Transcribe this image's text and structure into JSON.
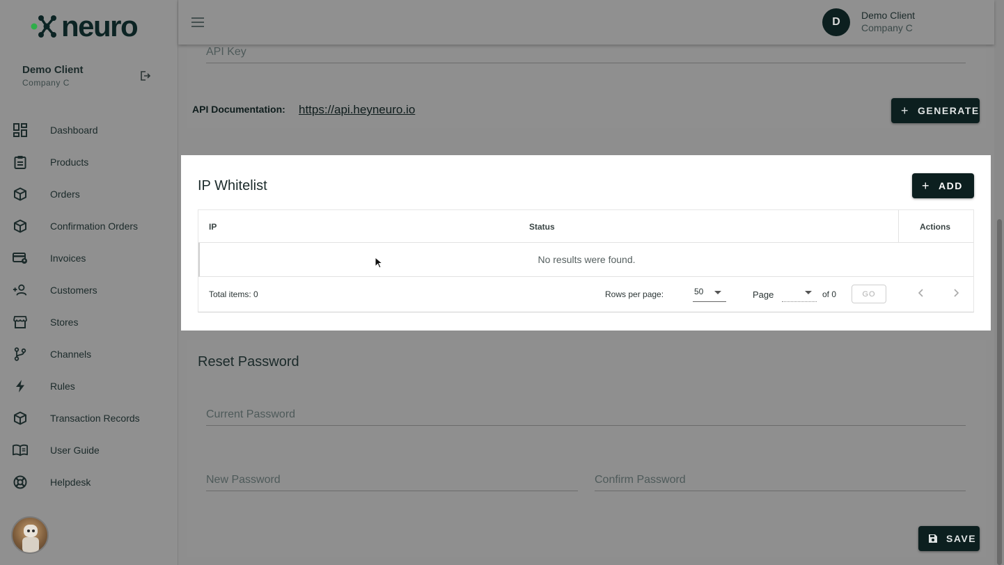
{
  "brand": {
    "name": "neuro"
  },
  "sidebar": {
    "user": {
      "name": "Demo Client",
      "company": "Company C"
    },
    "items": [
      {
        "label": "Dashboard",
        "icon": "dashboard-icon"
      },
      {
        "label": "Products",
        "icon": "clipboard-icon"
      },
      {
        "label": "Orders",
        "icon": "box-icon"
      },
      {
        "label": "Confirmation Orders",
        "icon": "box-icon"
      },
      {
        "label": "Invoices",
        "icon": "card-pin-icon"
      },
      {
        "label": "Customers",
        "icon": "add-user-icon"
      },
      {
        "label": "Stores",
        "icon": "store-icon"
      },
      {
        "label": "Channels",
        "icon": "branch-icon"
      },
      {
        "label": "Rules",
        "icon": "bolt-icon"
      },
      {
        "label": "Transaction Records",
        "icon": "box-icon"
      },
      {
        "label": "User Guide",
        "icon": "book-icon"
      },
      {
        "label": "Helpdesk",
        "icon": "lifebuoy-icon"
      }
    ]
  },
  "topbar": {
    "avatar_initial": "D",
    "user_name": "Demo Client",
    "company": "Company C"
  },
  "api": {
    "api_key_label": "API Key",
    "doc_label": "API Documentation:",
    "doc_link": "https://api.heyneuro.io",
    "generate_label": "GENERATE"
  },
  "ip_whitelist": {
    "title": "IP Whitelist",
    "add_label": "ADD",
    "columns": [
      "IP",
      "Status",
      "Actions"
    ],
    "empty_text": "No results were found.",
    "total_label": "Total items: 0",
    "rows_per_page_label": "Rows per page:",
    "rows_per_page_value": "50",
    "page_label": "Page",
    "of_label": "of 0",
    "go_label": "GO"
  },
  "reset_password": {
    "title": "Reset Password",
    "current_label": "Current Password",
    "new_label": "New Password",
    "confirm_label": "Confirm Password",
    "save_label": "SAVE"
  },
  "colors": {
    "primary": "#0c1f1f",
    "accent_green": "#2fae4a",
    "overlay": "#8f8f8f"
  }
}
